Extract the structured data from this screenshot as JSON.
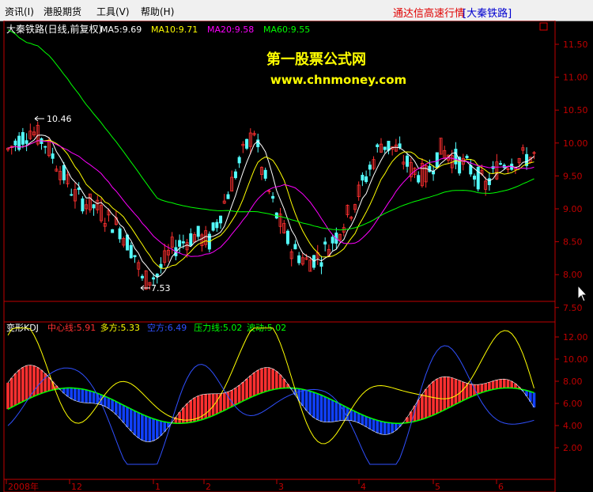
{
  "menu": {
    "items": [
      "资讯(I)",
      "港股期货",
      "工具(V)",
      "帮助(H)"
    ],
    "title": "通达信高速行情",
    "stock": "[大秦铁路]"
  },
  "price_panel": {
    "title": "大秦铁路(日线,前复权)",
    "ma_labels": [
      {
        "text": "MA5:9.69",
        "color": "#ffffff"
      },
      {
        "text": "MA10:9.71",
        "color": "#ffff00"
      },
      {
        "text": "MA20:9.58",
        "color": "#ff00ff"
      },
      {
        "text": "MA60:9.55",
        "color": "#00ff00"
      }
    ],
    "watermark_line1": "第一股票公式网",
    "watermark_line2": "www.chnmoney.com",
    "high_label": "10.46",
    "low_label": "7.53",
    "y_ticks": [
      "11.50",
      "11.00",
      "10.50",
      "10.00",
      "9.50",
      "9.00",
      "8.50",
      "8.00",
      "7.50"
    ]
  },
  "kdj_panel": {
    "title": "变形KDJ",
    "labels": [
      {
        "text": "中心线:5.91",
        "color": "#ff3030"
      },
      {
        "text": "多方:5.33",
        "color": "#ffff00"
      },
      {
        "text": "空方:6.49",
        "color": "#3050ff"
      },
      {
        "text": "压力线:5.02",
        "color": "#00ff00"
      },
      {
        "text": "波动:5.02",
        "color": "#00ff00"
      }
    ],
    "y_ticks": [
      "12.00",
      "10.00",
      "8.00",
      "6.00",
      "4.00",
      "2.00"
    ]
  },
  "x_axis": {
    "labels": [
      "2008年",
      "12",
      "1",
      "2",
      "3",
      "4",
      "5",
      "6"
    ]
  },
  "colors": {
    "up": "#ff3030",
    "down": "#54ffff",
    "ma5": "#ffffff",
    "ma10": "#ffff00",
    "ma20": "#ff00ff",
    "ma60": "#00ff00",
    "axis": "#c00000",
    "watermark": "#ffff00"
  }
}
